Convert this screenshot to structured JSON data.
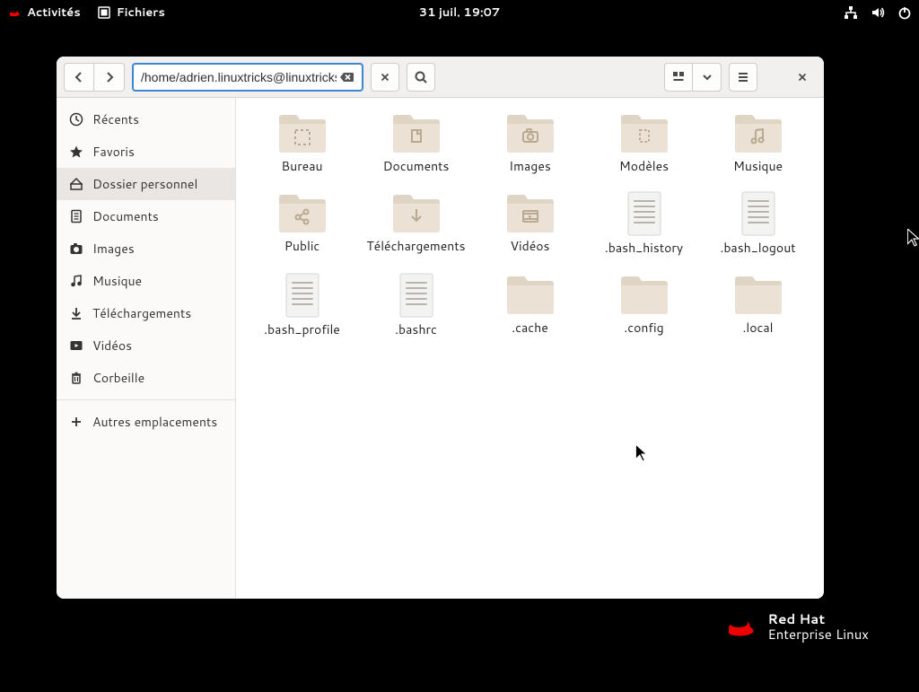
{
  "panel": {
    "activities": "Activités",
    "app": "Fichiers",
    "clock": "31 juil.  19:07"
  },
  "headerbar": {
    "path": "/home/adrien.linuxtricks@linuxtrickstest.lan"
  },
  "sidebar": {
    "items": [
      {
        "label": "Récents",
        "icon": "clock"
      },
      {
        "label": "Favoris",
        "icon": "star"
      },
      {
        "label": "Dossier personnel",
        "icon": "home",
        "selected": true
      },
      {
        "label": "Documents",
        "icon": "document"
      },
      {
        "label": "Images",
        "icon": "camera"
      },
      {
        "label": "Musique",
        "icon": "music"
      },
      {
        "label": "Téléchargements",
        "icon": "download"
      },
      {
        "label": "Vidéos",
        "icon": "video"
      },
      {
        "label": "Corbeille",
        "icon": "trash"
      }
    ],
    "other": "Autres emplacements"
  },
  "files": [
    {
      "label": "Bureau",
      "type": "folder",
      "glyph": "desktop"
    },
    {
      "label": "Documents",
      "type": "folder",
      "glyph": "document"
    },
    {
      "label": "Images",
      "type": "folder",
      "glyph": "camera"
    },
    {
      "label": "Modèles",
      "type": "folder",
      "glyph": "template"
    },
    {
      "label": "Musique",
      "type": "folder",
      "glyph": "music"
    },
    {
      "label": "Public",
      "type": "folder",
      "glyph": "share"
    },
    {
      "label": "Téléchargements",
      "type": "folder",
      "glyph": "download"
    },
    {
      "label": "Vidéos",
      "type": "folder",
      "glyph": "video"
    },
    {
      "label": ".bash_history",
      "type": "file"
    },
    {
      "label": ".bash_logout",
      "type": "file"
    },
    {
      "label": ".bash_profile",
      "type": "file"
    },
    {
      "label": ".bashrc",
      "type": "file"
    },
    {
      "label": ".cache",
      "type": "folder",
      "glyph": "plain"
    },
    {
      "label": ".config",
      "type": "folder",
      "glyph": "plain"
    },
    {
      "label": ".local",
      "type": "folder",
      "glyph": "plain"
    }
  ],
  "brand": {
    "line1": "Red Hat",
    "line2": "Enterprise Linux"
  }
}
